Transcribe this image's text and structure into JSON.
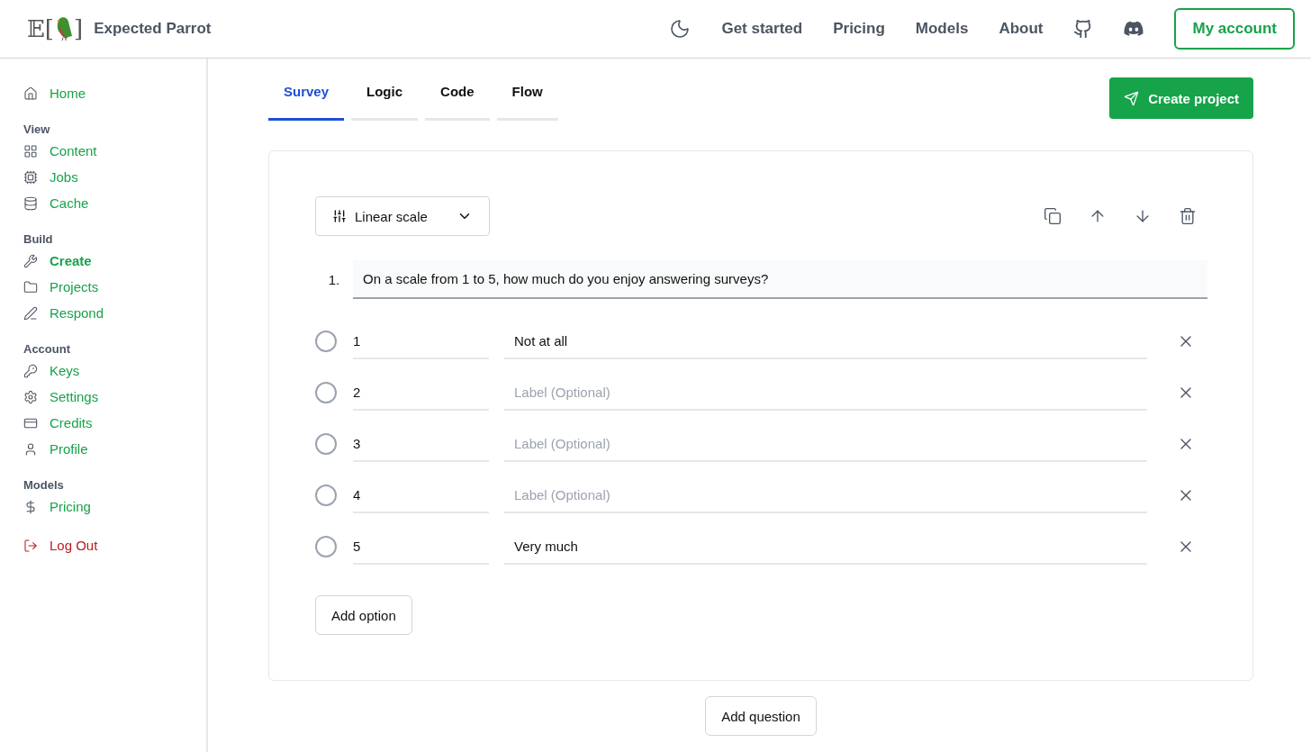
{
  "header": {
    "logo": {
      "left": "𝔼[",
      "right": "]"
    },
    "brand": "Expected Parrot",
    "nav": [
      "Get started",
      "Pricing",
      "Models",
      "About"
    ],
    "account_button": "My account"
  },
  "sidebar": {
    "groups": [
      {
        "items": [
          {
            "label": "Home",
            "selected": false,
            "kind": "link"
          }
        ]
      },
      {
        "title": "View",
        "items": [
          {
            "label": "Content",
            "selected": false,
            "kind": "link"
          },
          {
            "label": "Jobs",
            "selected": false,
            "kind": "link"
          },
          {
            "label": "Cache",
            "selected": false,
            "kind": "link"
          }
        ]
      },
      {
        "title": "Build",
        "items": [
          {
            "label": "Create",
            "selected": true,
            "kind": "link"
          },
          {
            "label": "Projects",
            "selected": false,
            "kind": "link"
          },
          {
            "label": "Respond",
            "selected": false,
            "kind": "link"
          }
        ]
      },
      {
        "title": "Account",
        "items": [
          {
            "label": "Keys",
            "selected": false,
            "kind": "link"
          },
          {
            "label": "Settings",
            "selected": false,
            "kind": "link"
          },
          {
            "label": "Credits",
            "selected": false,
            "kind": "link"
          },
          {
            "label": "Profile",
            "selected": false,
            "kind": "link"
          }
        ]
      },
      {
        "title": "Models",
        "items": [
          {
            "label": "Pricing",
            "selected": false,
            "kind": "link"
          }
        ]
      },
      {
        "items": [
          {
            "label": "Log Out",
            "selected": false,
            "kind": "logout"
          }
        ]
      }
    ]
  },
  "tabs": [
    {
      "label": "Survey",
      "selected": true
    },
    {
      "label": "Logic",
      "selected": false
    },
    {
      "label": "Code",
      "selected": false
    },
    {
      "label": "Flow",
      "selected": false
    }
  ],
  "create_button": "Create project",
  "question": {
    "type_select": "Linear scale",
    "number": "1.",
    "text": "On a scale from 1 to 5, how much do you enjoy answering surveys?",
    "options": [
      {
        "value": "1",
        "label": "Not at all",
        "checked": false
      },
      {
        "value": "2",
        "placeholder": "Label (Optional)",
        "checked": false
      },
      {
        "value": "3",
        "placeholder": "Label (Optional)",
        "checked": false
      },
      {
        "value": "4",
        "placeholder": "Label (Optional)",
        "checked": false
      },
      {
        "value": "5",
        "label": "Very much",
        "checked": false
      }
    ],
    "add_option": "Add option"
  },
  "add_question": "Add question"
}
